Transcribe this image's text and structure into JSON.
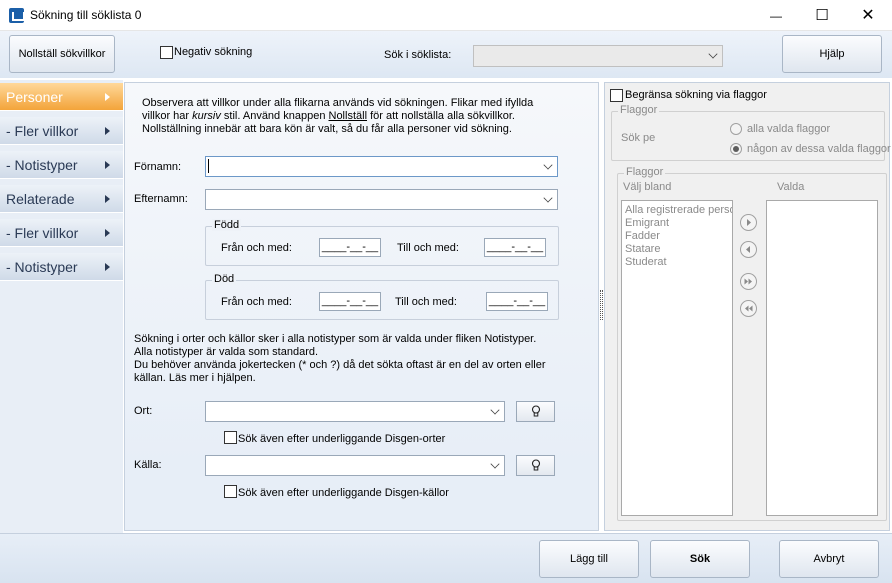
{
  "window": {
    "title": "Sökning till söklista 0",
    "minimize_glyph": "—",
    "maximize_glyph": "☐",
    "close_glyph": "✕"
  },
  "toolbar": {
    "reset_label": "Nollställ sökvillkor",
    "negative_search_label": "Negativ sökning",
    "negative_search_checked": false,
    "search_in_list_label": "Sök i söklista:",
    "search_in_list_value": "",
    "help_label": "Hjälp"
  },
  "sidebar": {
    "items": [
      {
        "label": "Personer",
        "active": true
      },
      {
        "label": "- Fler villkor",
        "active": false
      },
      {
        "label": "- Notistyper",
        "active": false
      },
      {
        "label": "Relaterade",
        "active": false
      },
      {
        "label": "- Fler villkor",
        "active": false
      },
      {
        "label": "- Notistyper",
        "active": false
      }
    ]
  },
  "main": {
    "info_line1": "Observera att villkor under alla flikarna används vid sökningen. Flikar med ifyllda",
    "info_line2_a": "villkor har ",
    "info_line2_italic": "kursiv",
    "info_line2_b": " stil. Använd knappen ",
    "info_line2_underline": "Nollställ",
    "info_line2_c": " för att nollställa alla sökvillkor.",
    "info_line3": "Nollställning innebär att bara kön är valt, så du får alla personer vid sökning.",
    "firstname_label": "Förnamn:",
    "firstname_value": "",
    "lastname_label": "Efternamn:",
    "lastname_value": "",
    "born_title": "Född",
    "died_title": "Död",
    "from_label": "Från och med:",
    "to_label": "Till och med:",
    "date_placeholder": "____-__-__",
    "places_info1": "Sökning i orter och källor sker i alla notistyper som är valda under fliken Notistyper.",
    "places_info2": "Alla notistyper är valda som standard.",
    "places_info3": "Du behöver använda jokertecken (* och ?) då det sökta oftast är en del av orten eller",
    "places_info4": "källan. Läs mer i hjälpen.",
    "place_label": "Ort:",
    "place_value": "",
    "place_sub_label": "Sök även efter underliggande Disgen-orter",
    "source_label": "Källa:",
    "source_value": "",
    "source_sub_label": "Sök även efter underliggande Disgen-källor"
  },
  "flags": {
    "limit_label": "Begränsa sökning via flaggor",
    "limit_checked": false,
    "group_title": "Flaggor",
    "search_on_label": "Sök pe",
    "radio_all": "alla valda flaggor",
    "radio_any": "någon av dessa valda flaggor",
    "radio_selected": "any",
    "list_group_title": "Flaggor",
    "choose_from_label": "Välj bland",
    "selected_label": "Valda",
    "available": [
      "Alla registrerade perso",
      "Emigrant",
      "Fadder",
      "Statare",
      "Studerat"
    ],
    "selected": []
  },
  "bottom": {
    "add_label": "Lägg till",
    "search_label": "Sök",
    "cancel_label": "Avbryt"
  }
}
